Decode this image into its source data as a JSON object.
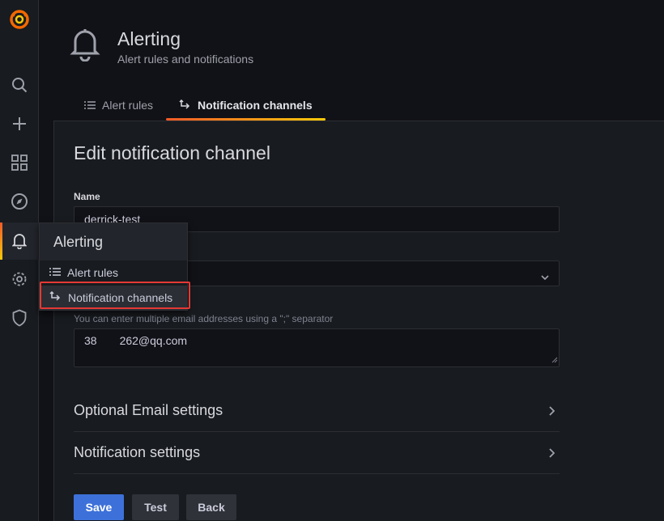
{
  "sidebar": {
    "items": [
      {
        "icon": "grafana-logo-icon"
      },
      {
        "icon": "search-icon"
      },
      {
        "icon": "plus-icon"
      },
      {
        "icon": "dashboards-icon"
      },
      {
        "icon": "explore-icon"
      },
      {
        "icon": "bell-icon",
        "active": true
      },
      {
        "icon": "gear-icon"
      },
      {
        "icon": "shield-icon"
      }
    ]
  },
  "header": {
    "title": "Alerting",
    "subtitle": "Alert rules and notifications",
    "icon": "bell-icon"
  },
  "tabs": [
    {
      "label": "Alert rules",
      "icon": "list-icon",
      "active": false
    },
    {
      "label": "Notification channels",
      "icon": "comment-alt-share-icon",
      "active": true
    }
  ],
  "form": {
    "title": "Edit notification channel",
    "name_label": "Name",
    "name_value": "derrick-test",
    "type_value": "",
    "addresses_hint": "You can enter multiple email addresses using a \";\" separator",
    "addresses_value": "38  262@qq.com",
    "sections": [
      {
        "label": "Optional Email settings"
      },
      {
        "label": "Notification settings"
      }
    ],
    "buttons": {
      "save": "Save",
      "test": "Test",
      "back": "Back"
    }
  },
  "flyout": {
    "title": "Alerting",
    "items": [
      {
        "label": "Alert rules",
        "icon": "list-icon"
      },
      {
        "label": "Notification channels",
        "icon": "comment-alt-share-icon",
        "highlighted": true
      }
    ]
  },
  "colors": {
    "primary": "#3d71d9",
    "accent_gradient_start": "#f05a28",
    "accent_gradient_end": "#fbca0a",
    "highlight_box": "#e53935"
  }
}
